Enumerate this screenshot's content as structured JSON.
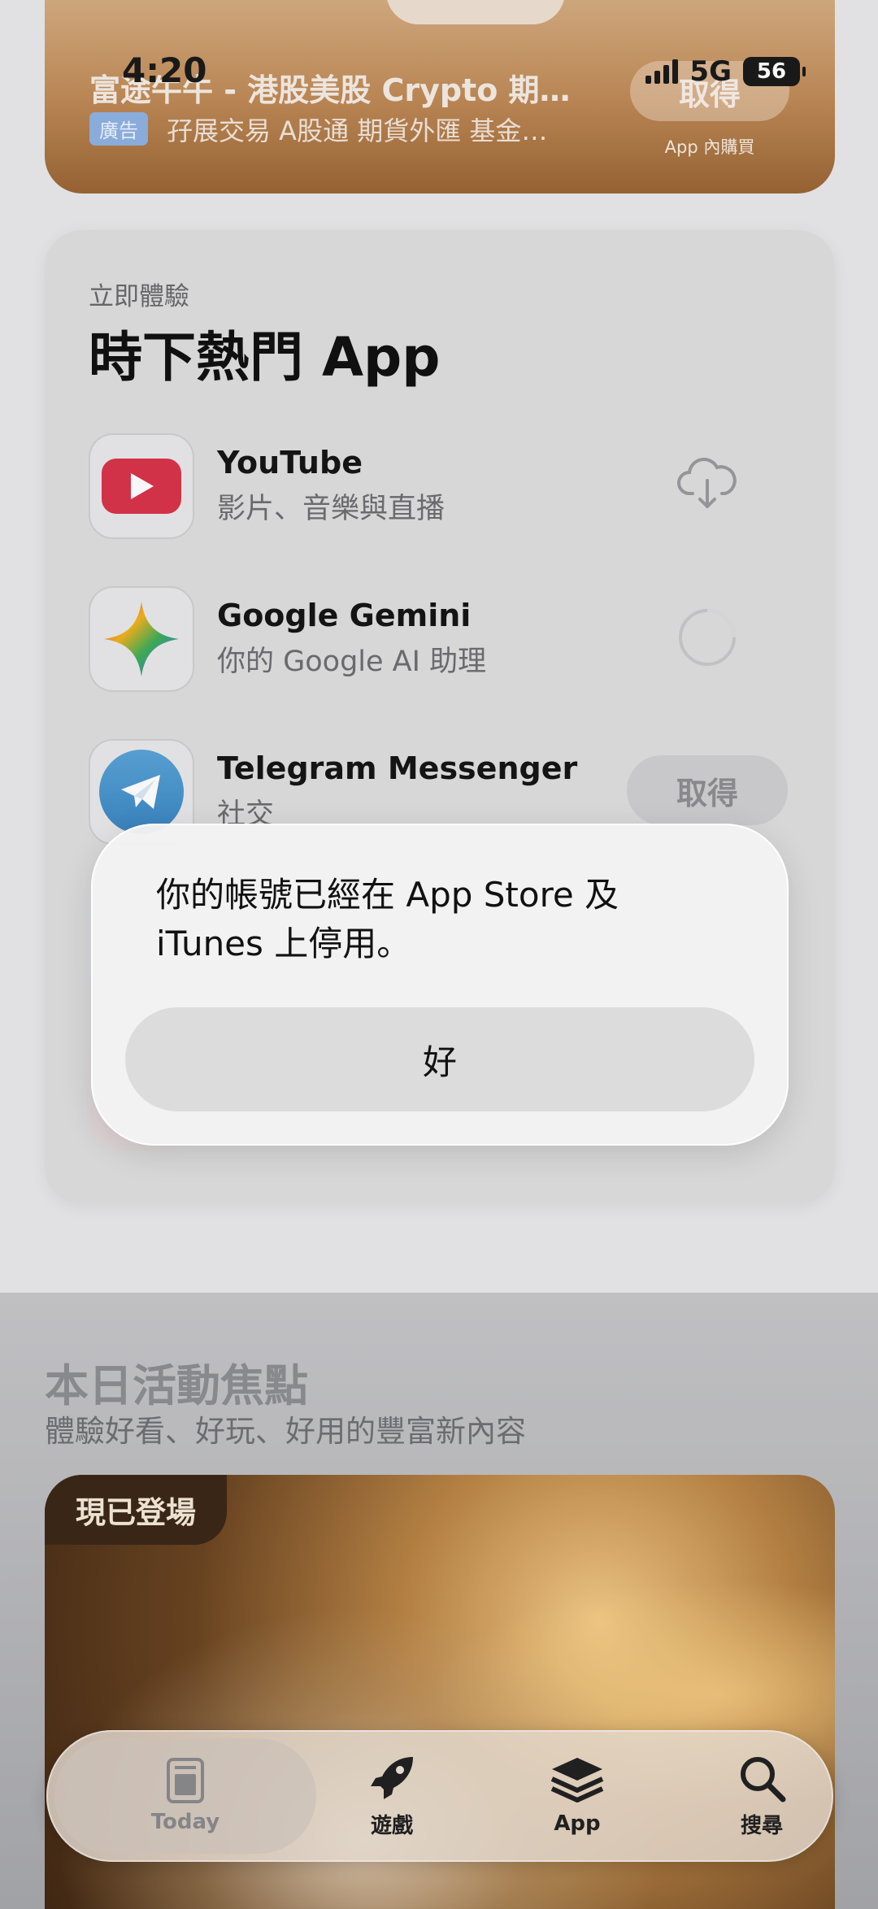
{
  "status_bar": {
    "time": "4:20",
    "network": "5G",
    "battery": "56"
  },
  "ad": {
    "title": "富途牛牛 - 港股美股 Crypto 期…",
    "badge": "廣告",
    "subtitle": "孖展交易 A股通 期貨外匯 基金…",
    "get_label": "取得",
    "iap_note": "App 內購買"
  },
  "trending": {
    "eyebrow": "立即體驗",
    "title": "時下熱門 App",
    "apps": [
      {
        "name": "YouTube",
        "subtitle": "影片、音樂與直播",
        "action": "cloud-download"
      },
      {
        "name": "Google Gemini",
        "subtitle": "你的 Google AI 助理",
        "action": "loading"
      },
      {
        "name": "Telegram Messenger",
        "subtitle": "社交",
        "action": "get",
        "get_label": "取得"
      }
    ]
  },
  "alert": {
    "message": "你的帳號已經在 App Store 及 iTunes 上停用。",
    "ok_label": "好"
  },
  "today": {
    "title": "本日活動焦點",
    "subtitle": "體驗好看、好玩、好用的豐富新內容",
    "feature_tag": "現已登場"
  },
  "tabbar": {
    "tabs": [
      {
        "label": "Today",
        "icon": "today-icon",
        "active": true
      },
      {
        "label": "遊戲",
        "icon": "rocket-icon",
        "active": false
      },
      {
        "label": "App",
        "icon": "layers-icon",
        "active": false
      },
      {
        "label": "搜尋",
        "icon": "search-icon",
        "active": false
      }
    ]
  }
}
